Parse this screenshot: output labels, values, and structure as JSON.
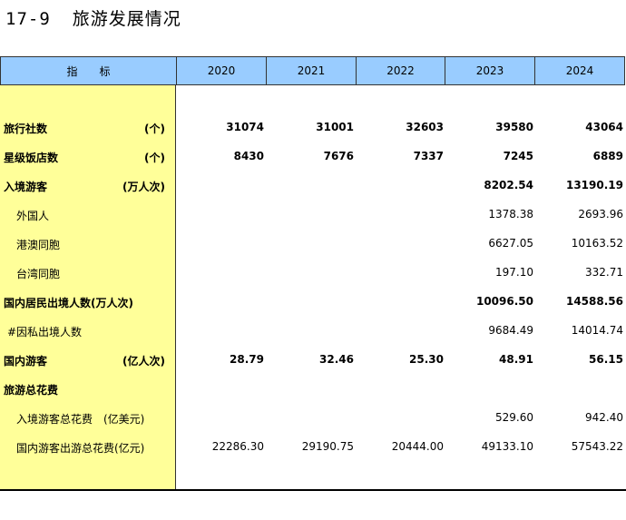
{
  "title": {
    "number": "17-9",
    "text": "旅游发展情况"
  },
  "header": {
    "label": "指　　标",
    "years": [
      "2020",
      "2021",
      "2022",
      "2023",
      "2024"
    ]
  },
  "rows": [
    {
      "label": "旅行社数",
      "unit": "(个)",
      "bold": true,
      "style": "main",
      "values": [
        "31074",
        "31001",
        "32603",
        "39580",
        "43064"
      ]
    },
    {
      "label": "星级饭店数",
      "unit": "(个)",
      "bold": true,
      "style": "main",
      "values": [
        "8430",
        "7676",
        "7337",
        "7245",
        "6889"
      ]
    },
    {
      "label": "入境游客",
      "unit": "(万人次)",
      "bold": true,
      "style": "main",
      "values": [
        "",
        "",
        "",
        "8202.54",
        "13190.19"
      ]
    },
    {
      "label": "外国人",
      "unit": "",
      "bold": false,
      "style": "ind",
      "values": [
        "",
        "",
        "",
        "1378.38",
        "2693.96"
      ]
    },
    {
      "label": "港澳同胞",
      "unit": "",
      "bold": false,
      "style": "ind",
      "values": [
        "",
        "",
        "",
        "6627.05",
        "10163.52"
      ]
    },
    {
      "label": "台湾同胞",
      "unit": "",
      "bold": false,
      "style": "ind",
      "values": [
        "",
        "",
        "",
        "197.10",
        "332.71"
      ]
    },
    {
      "label": "国内居民出境人数(万人次)",
      "unit": "",
      "bold": true,
      "style": "main",
      "values": [
        "",
        "",
        "",
        "10096.50",
        "14588.56"
      ]
    },
    {
      "label": "#因私出境人数",
      "unit": "",
      "bold": false,
      "style": "hash",
      "values": [
        "",
        "",
        "",
        "9684.49",
        "14014.74"
      ]
    },
    {
      "label": "国内游客",
      "unit": "(亿人次)",
      "bold": true,
      "style": "main",
      "values": [
        "28.79",
        "32.46",
        "25.30",
        "48.91",
        "56.15"
      ]
    },
    {
      "label": "旅游总花费",
      "unit": "",
      "bold": true,
      "style": "main",
      "values": [
        "",
        "",
        "",
        "",
        ""
      ]
    },
    {
      "label": "入境游客总花费　(亿美元)",
      "unit": "",
      "bold": false,
      "style": "ind",
      "values": [
        "",
        "",
        "",
        "529.60",
        "942.40"
      ]
    },
    {
      "label": "国内游客出游总花费(亿元)",
      "unit": "",
      "bold": false,
      "style": "ind",
      "values": [
        "22286.30",
        "29190.75",
        "20444.00",
        "49133.10",
        "57543.22"
      ]
    }
  ]
}
